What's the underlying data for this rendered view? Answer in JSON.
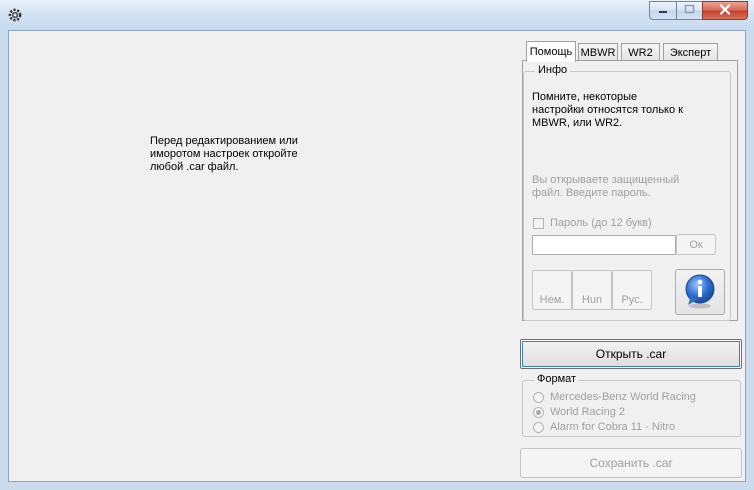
{
  "window": {
    "icon": "gear-icon",
    "controls": [
      "minimize-icon",
      "maximize-icon",
      "close-icon"
    ]
  },
  "main": {
    "hint": "Перед редактированием или\nиморотом настроек откройте\nлюбой .car файл."
  },
  "tabs": [
    {
      "label": "Помощь",
      "active": true
    },
    {
      "label": "MBWR",
      "active": false
    },
    {
      "label": "WR2",
      "active": false
    },
    {
      "label": "Эксперт",
      "active": false
    }
  ],
  "info": {
    "group_label": "Инфо",
    "text": "Помните, некоторые\nнастройки относятся только к\nMBWR, или WR2.",
    "protected_text": "Вы открываете защищенный\nфайл. Введите пароль.",
    "password_checkbox_label": "Пароль (до 12 букв)",
    "password_value": "",
    "ok_label": "Ок",
    "languages": [
      "Нем.",
      "Hun",
      "Рус."
    ],
    "info_icon": "info-icon"
  },
  "open_button_label": "Открыть .car",
  "format": {
    "group_label": "Формат",
    "options": [
      {
        "label": "Mercedes-Benz World Racing",
        "checked": false
      },
      {
        "label": "World Racing 2",
        "checked": true
      },
      {
        "label": "Alarm for Cobra 11 - Nitro",
        "checked": false
      }
    ]
  },
  "save_button_label": "Сохранить .car",
  "colors": {
    "frame": "#c9dbed",
    "client": "#f0f0f0",
    "disabled_text": "#a0a0a0",
    "info_blue": "#2f6fd0"
  }
}
